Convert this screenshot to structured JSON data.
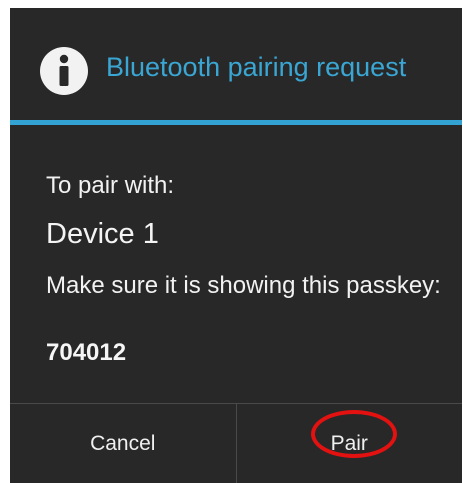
{
  "dialog": {
    "title": "Bluetooth pairing request",
    "icon": "info-icon",
    "accent_color": "#33a3d3",
    "pair_with_label": "To pair with:",
    "device_name": "Device 1",
    "instruction": "Make sure it is showing this passkey:",
    "passkey": "704012"
  },
  "buttons": {
    "cancel_label": "Cancel",
    "pair_label": "Pair"
  },
  "annotation": {
    "highlight_color": "#e41111",
    "highlight_target": "Pair"
  }
}
